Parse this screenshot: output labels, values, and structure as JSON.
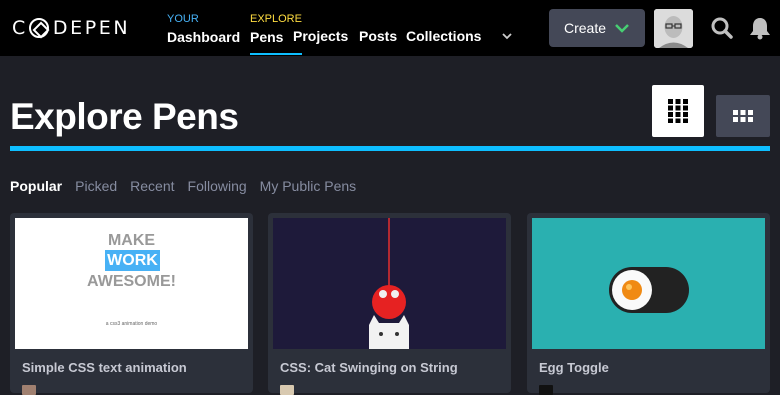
{
  "header": {
    "logo_text": "DEPEN",
    "logo_first": "C",
    "nav": [
      {
        "small": "YOUR",
        "big": "Dashboard"
      },
      {
        "small": "EXPLORE",
        "big": "Pens"
      }
    ],
    "links": [
      "Projects",
      "Posts",
      "Collections"
    ],
    "create_label": "Create"
  },
  "main": {
    "title": "Explore Pens",
    "tabs": [
      "Popular",
      "Picked",
      "Recent",
      "Following",
      "My Public Pens"
    ],
    "cards": [
      {
        "title": "Simple CSS text animation",
        "make": "MAKE",
        "work": "WORK",
        "awesome": "AWESOME!",
        "sub": "a css3 animation demo"
      },
      {
        "title": "CSS: Cat Swinging on String"
      },
      {
        "title": "Egg Toggle"
      }
    ]
  },
  "colors": {
    "accent": "#0ebeff",
    "green": "#47cf73",
    "nav_bg": "#000000",
    "page_bg": "#1e1f26"
  }
}
